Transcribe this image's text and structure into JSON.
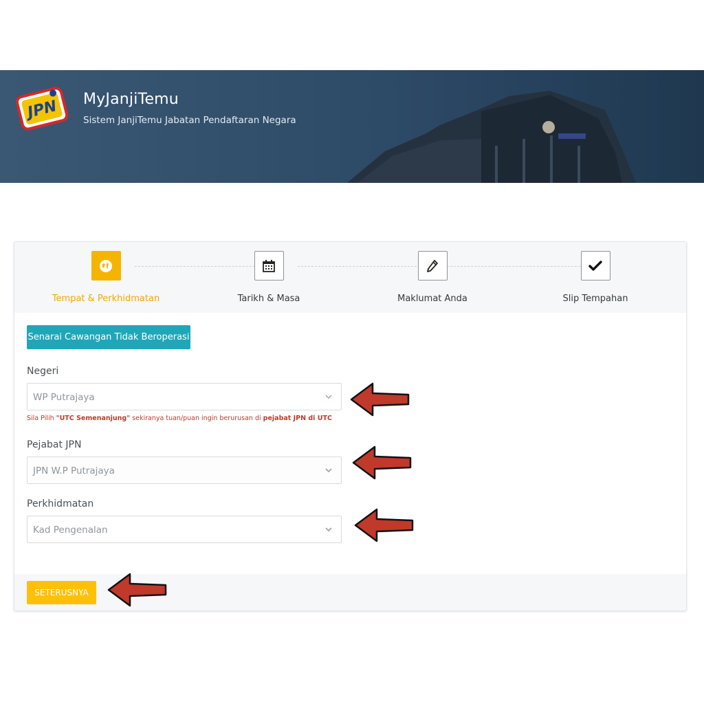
{
  "header": {
    "title": "MyJanjiTemu",
    "subtitle": "Sistem JanjiTemu Jabatan Pendaftaran Negara",
    "logo_text": "JPN"
  },
  "steps": [
    {
      "label": "Tempat & Perkhidmatan",
      "icon": "globe-icon",
      "active": true
    },
    {
      "label": "Tarikh & Masa",
      "icon": "calendar-icon",
      "active": false
    },
    {
      "label": "Maklumat Anda",
      "icon": "pencil-icon",
      "active": false
    },
    {
      "label": "Slip Tempahan",
      "icon": "checkmark-icon",
      "active": false
    }
  ],
  "form": {
    "closed_branches_button": "Senarai Cawangan Tidak Beroperasi",
    "negeri": {
      "label": "Negeri",
      "value": "WP Putrajaya"
    },
    "hint": {
      "part1": "Sila Pilih ",
      "bold1": "\"UTC Semenanjung\"",
      "part2": " sekiranya tuan/puan ingin berurusan di ",
      "bold2": "pejabat JPN di UTC"
    },
    "pejabat": {
      "label": "Pejabat JPN",
      "value": "JPN W.P Putrajaya"
    },
    "perkhidmatan": {
      "label": "Perkhidmatan",
      "value": "Kad Pengenalan"
    }
  },
  "footer": {
    "next_button": "SETERUSNYA"
  },
  "colors": {
    "accent": "#f5b400",
    "teal": "#1fa7b8",
    "banner": "#2d4a67",
    "arrow": "#c0392b"
  }
}
